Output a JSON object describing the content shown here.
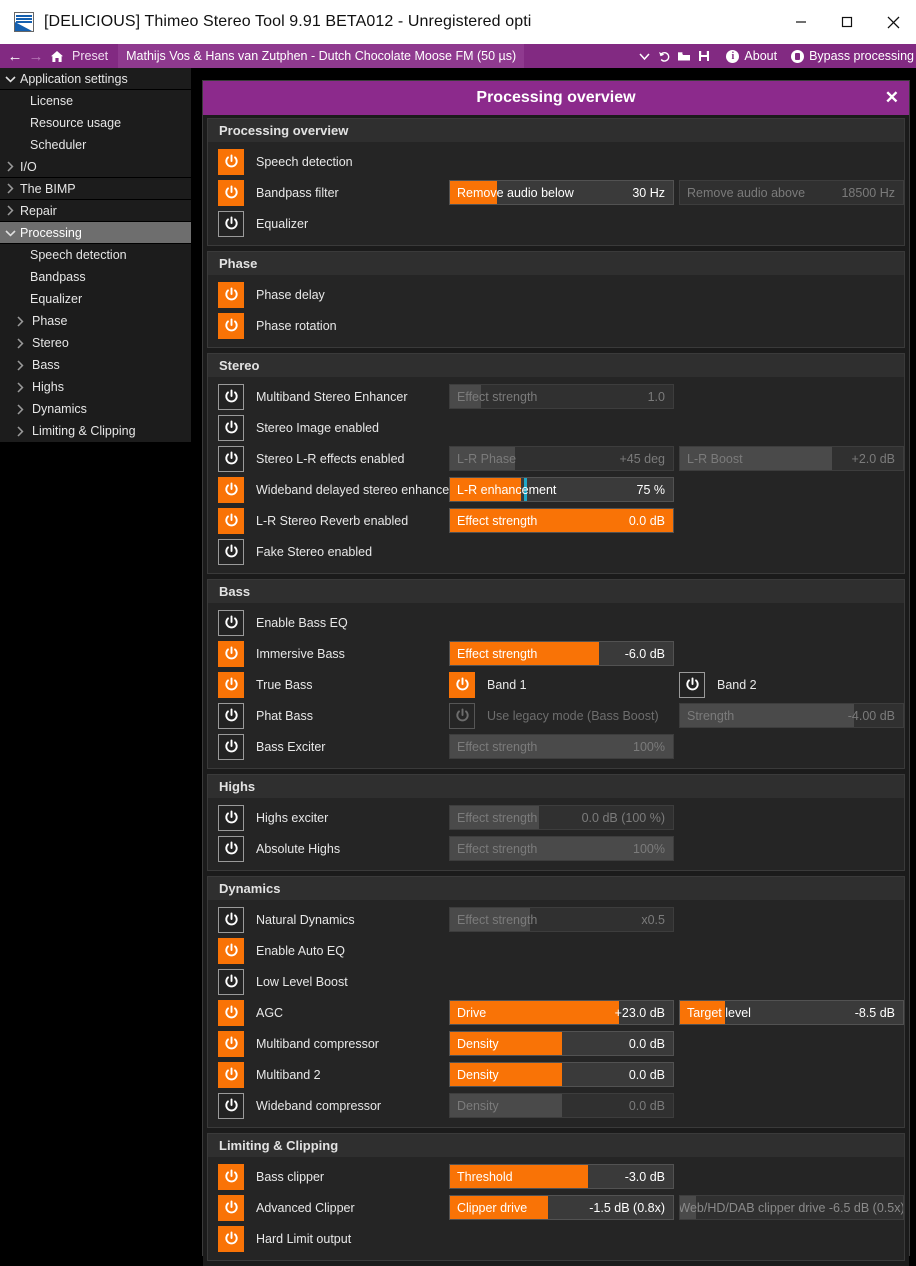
{
  "window": {
    "title": "[DELICIOUS] Thimeo Stereo Tool 9.91 BETA012 - Unregistered opti",
    "minimize_label": "–",
    "maximize_label": "☐",
    "close_label": "✕"
  },
  "toolbar": {
    "back_icon": "←",
    "forward_icon": "→",
    "home_icon": "home-icon",
    "preset_label": "Preset",
    "preset_value": "Mathijs Vos & Hans van Zutphen - Dutch Chocolate Moose FM (50 µs)",
    "dropdown_icon": "ˇ",
    "revert_icon": "↺",
    "open_icon": "open-folder-icon",
    "save_icon": "save-disk-icon",
    "about_label": "About",
    "bypass_label": "Bypass processing"
  },
  "sidebar": {
    "items": [
      {
        "label": "Application settings",
        "level": 1,
        "chevron": "down",
        "selected": false
      },
      {
        "label": "License",
        "level": 2,
        "chevron": "none",
        "selected": false
      },
      {
        "label": "Resource usage",
        "level": 2,
        "chevron": "none",
        "selected": false
      },
      {
        "label": "Scheduler",
        "level": 2,
        "chevron": "none",
        "selected": false
      },
      {
        "label": "I/O",
        "level": 1,
        "chevron": "right",
        "selected": false
      },
      {
        "label": "The BIMP",
        "level": 1,
        "chevron": "right",
        "selected": false
      },
      {
        "label": "Repair",
        "level": 1,
        "chevron": "right",
        "selected": false
      },
      {
        "label": "Processing",
        "level": 1,
        "chevron": "down",
        "selected": true
      },
      {
        "label": "Speech detection",
        "level": 2,
        "chevron": "none",
        "selected": false
      },
      {
        "label": "Bandpass",
        "level": 2,
        "chevron": "none",
        "selected": false
      },
      {
        "label": "Equalizer",
        "level": 2,
        "chevron": "none",
        "selected": false
      },
      {
        "label": "Phase",
        "level": 2,
        "chevron": "right",
        "selected": false
      },
      {
        "label": "Stereo",
        "level": 2,
        "chevron": "right",
        "selected": false
      },
      {
        "label": "Bass",
        "level": 2,
        "chevron": "right",
        "selected": false
      },
      {
        "label": "Highs",
        "level": 2,
        "chevron": "right",
        "selected": false
      },
      {
        "label": "Dynamics",
        "level": 2,
        "chevron": "right",
        "selected": false
      },
      {
        "label": "Limiting & Clipping",
        "level": 2,
        "chevron": "right",
        "selected": false
      }
    ]
  },
  "panel": {
    "title": "Processing overview",
    "close_icon": "✕",
    "accent_color": "#8c2a8c",
    "on_color": "#f97306",
    "tick_color": "#1ea7c8",
    "sections": [
      {
        "title": "Processing overview",
        "rows": [
          {
            "label": "Speech detection",
            "enabled": true,
            "dim": false,
            "widgets": []
          },
          {
            "label": "Bandpass filter",
            "enabled": true,
            "dim": false,
            "widgets": [
              {
                "slot": "a",
                "type": "slider",
                "label": "Remove audio below",
                "value": "30 Hz",
                "fill": 21,
                "disabled": false
              },
              {
                "slot": "b",
                "type": "slider",
                "label": "Remove audio above",
                "value": "18500 Hz",
                "fill": 0,
                "disabled": true
              }
            ]
          },
          {
            "label": "Equalizer",
            "enabled": false,
            "dim": false,
            "widgets": []
          }
        ]
      },
      {
        "title": "Phase",
        "rows": [
          {
            "label": "Phase delay",
            "enabled": true,
            "dim": false,
            "widgets": []
          },
          {
            "label": "Phase rotation",
            "enabled": true,
            "dim": false,
            "widgets": []
          }
        ]
      },
      {
        "title": "Stereo",
        "rows": [
          {
            "label": "Multiband Stereo Enhancer",
            "enabled": false,
            "dim": false,
            "widgets": [
              {
                "slot": "a",
                "type": "slider",
                "label": "Effect strength",
                "value": "1.0",
                "fill": 14,
                "disabled": true
              }
            ]
          },
          {
            "label": "Stereo Image enabled",
            "enabled": false,
            "dim": false,
            "widgets": []
          },
          {
            "label": "Stereo L-R effects enabled",
            "enabled": false,
            "dim": false,
            "widgets": [
              {
                "slot": "a",
                "type": "slider",
                "label": "L-R Phase",
                "value": "+45 deg",
                "fill": 29,
                "disabled": true
              },
              {
                "slot": "b",
                "type": "slider",
                "label": "L-R Boost",
                "value": "+2.0 dB",
                "fill": 68,
                "disabled": true
              }
            ]
          },
          {
            "label": "Wideband delayed stereo enhancer",
            "enabled": true,
            "dim": false,
            "widgets": [
              {
                "slot": "a",
                "type": "slider",
                "label": "L-R enhancement",
                "value": "75 %",
                "fill": 32,
                "tick": 33,
                "disabled": false
              }
            ]
          },
          {
            "label": "L-R Stereo Reverb enabled",
            "enabled": true,
            "dim": false,
            "widgets": [
              {
                "slot": "a",
                "type": "slider",
                "label": "Effect strength",
                "value": "0.0 dB",
                "fill": 100,
                "disabled": false
              }
            ]
          },
          {
            "label": "Fake Stereo enabled",
            "enabled": false,
            "dim": false,
            "widgets": []
          }
        ]
      },
      {
        "title": "Bass",
        "rows": [
          {
            "label": "Enable Bass EQ",
            "enabled": false,
            "dim": false,
            "widgets": []
          },
          {
            "label": "Immersive Bass",
            "enabled": true,
            "dim": false,
            "widgets": [
              {
                "slot": "a",
                "type": "slider",
                "label": "Effect strength",
                "value": "-6.0 dB",
                "fill": 67,
                "disabled": false
              }
            ]
          },
          {
            "label": "True Bass",
            "enabled": true,
            "dim": false,
            "widgets": [
              {
                "slot": "a",
                "type": "toggle",
                "label": "Band 1",
                "enabled": true,
                "disabled": false
              },
              {
                "slot": "b",
                "type": "toggle",
                "label": "Band 2",
                "enabled": false,
                "disabled": false
              }
            ]
          },
          {
            "label": "Phat Bass",
            "enabled": false,
            "dim": false,
            "widgets": [
              {
                "slot": "a",
                "type": "toggle",
                "label": "Use legacy mode (Bass Boost)",
                "enabled": false,
                "disabled": true
              },
              {
                "slot": "b",
                "type": "slider",
                "label": "Strength",
                "value": "-4.00 dB",
                "fill": 78,
                "disabled": true
              }
            ]
          },
          {
            "label": "Bass Exciter",
            "enabled": false,
            "dim": false,
            "widgets": [
              {
                "slot": "a",
                "type": "slider",
                "label": "Effect strength",
                "value": "100%",
                "fill": 100,
                "disabled": true
              }
            ]
          }
        ]
      },
      {
        "title": "Highs",
        "rows": [
          {
            "label": "Highs exciter",
            "enabled": false,
            "dim": false,
            "widgets": [
              {
                "slot": "a",
                "type": "slider",
                "label": "Effect strength",
                "value": "0.0 dB (100 %)",
                "fill": 40,
                "disabled": true
              }
            ]
          },
          {
            "label": "Absolute Highs",
            "enabled": false,
            "dim": false,
            "widgets": [
              {
                "slot": "a",
                "type": "slider",
                "label": "Effect strength",
                "value": "100%",
                "fill": 100,
                "disabled": true
              }
            ]
          }
        ]
      },
      {
        "title": "Dynamics",
        "rows": [
          {
            "label": "Natural Dynamics",
            "enabled": false,
            "dim": false,
            "widgets": [
              {
                "slot": "a",
                "type": "slider",
                "label": "Effect strength",
                "value": "x0.5",
                "fill": 36,
                "disabled": true
              }
            ]
          },
          {
            "label": "Enable Auto EQ",
            "enabled": true,
            "dim": false,
            "widgets": []
          },
          {
            "label": "Low Level Boost",
            "enabled": false,
            "dim": false,
            "widgets": []
          },
          {
            "label": "AGC",
            "enabled": true,
            "dim": false,
            "widgets": [
              {
                "slot": "a",
                "type": "slider",
                "label": "Drive",
                "value": "+23.0 dB",
                "fill": 76,
                "disabled": false
              },
              {
                "slot": "b",
                "type": "slider",
                "label": "Target level",
                "value": "-8.5 dB",
                "fill": 20,
                "disabled": false
              }
            ]
          },
          {
            "label": "Multiband compressor",
            "enabled": true,
            "dim": false,
            "widgets": [
              {
                "slot": "a",
                "type": "slider",
                "label": "Density",
                "value": "0.0 dB",
                "fill": 50,
                "disabled": false
              }
            ]
          },
          {
            "label": "Multiband 2",
            "enabled": true,
            "dim": false,
            "widgets": [
              {
                "slot": "a",
                "type": "slider",
                "label": "Density",
                "value": "0.0 dB",
                "fill": 50,
                "disabled": false
              }
            ]
          },
          {
            "label": "Wideband compressor",
            "enabled": false,
            "dim": false,
            "widgets": [
              {
                "slot": "a",
                "type": "slider",
                "label": "Density",
                "value": "0.0 dB",
                "fill": 50,
                "disabled": true
              }
            ]
          }
        ]
      },
      {
        "title": "Limiting & Clipping",
        "rows": [
          {
            "label": "Bass clipper",
            "enabled": true,
            "dim": false,
            "widgets": [
              {
                "slot": "a",
                "type": "slider",
                "label": "Threshold",
                "value": "-3.0 dB",
                "fill": 62,
                "disabled": false
              }
            ]
          },
          {
            "label": "Advanced Clipper",
            "enabled": true,
            "dim": false,
            "widgets": [
              {
                "slot": "a",
                "type": "slider",
                "label": "Clipper drive",
                "value": "-1.5 dB (0.8x)",
                "fill": 44,
                "disabled": false
              },
              {
                "slot": "b",
                "type": "slider",
                "center_label": "Web/HD/DAB clipper drive -6.5 dB (0.5x)",
                "fill": 7,
                "disabled": true
              }
            ]
          },
          {
            "label": "Hard Limit output",
            "enabled": true,
            "dim": false,
            "widgets": []
          }
        ]
      }
    ]
  }
}
